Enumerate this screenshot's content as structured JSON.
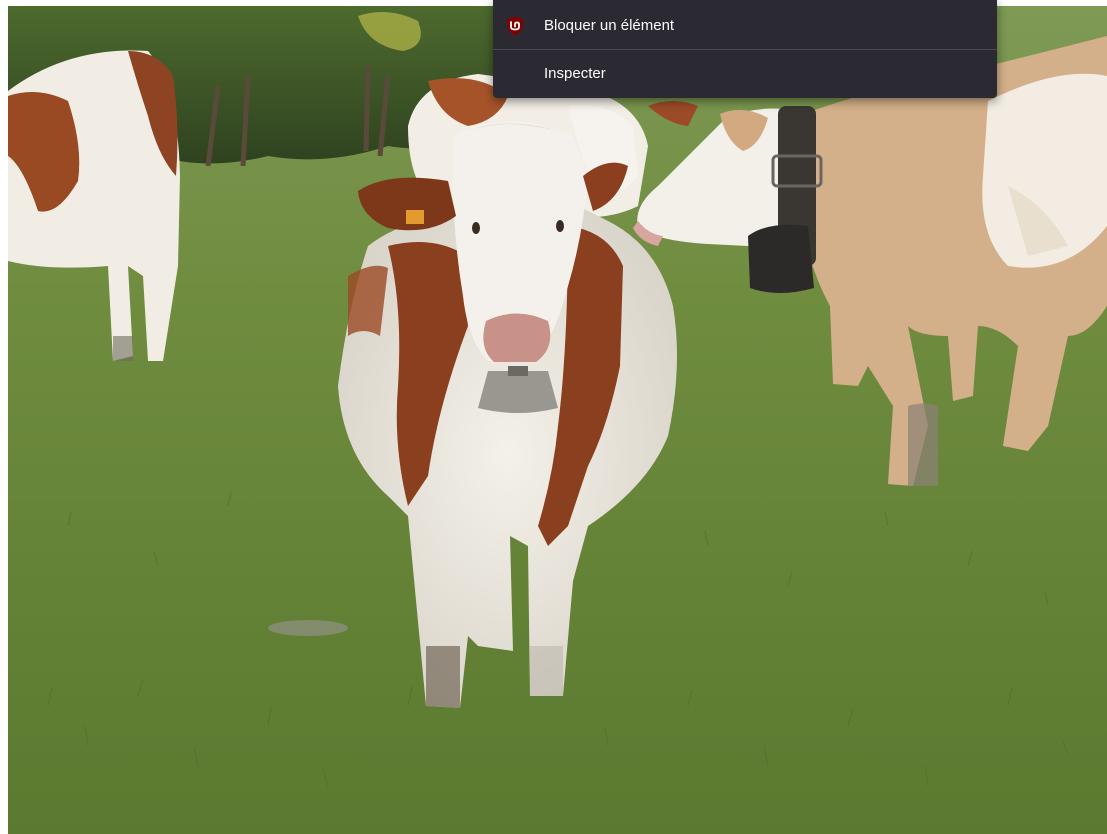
{
  "photo": {
    "subject": "cows-in-pasture"
  },
  "context_menu": {
    "items": [
      {
        "label": "Bloquer un élément",
        "icon": "ublock-shield-icon"
      },
      {
        "label": "Inspecter",
        "icon": ""
      }
    ]
  },
  "colors": {
    "menu_background": "#2b2a33",
    "menu_text": "#fbfbfe",
    "ublock_red": "#800000"
  }
}
